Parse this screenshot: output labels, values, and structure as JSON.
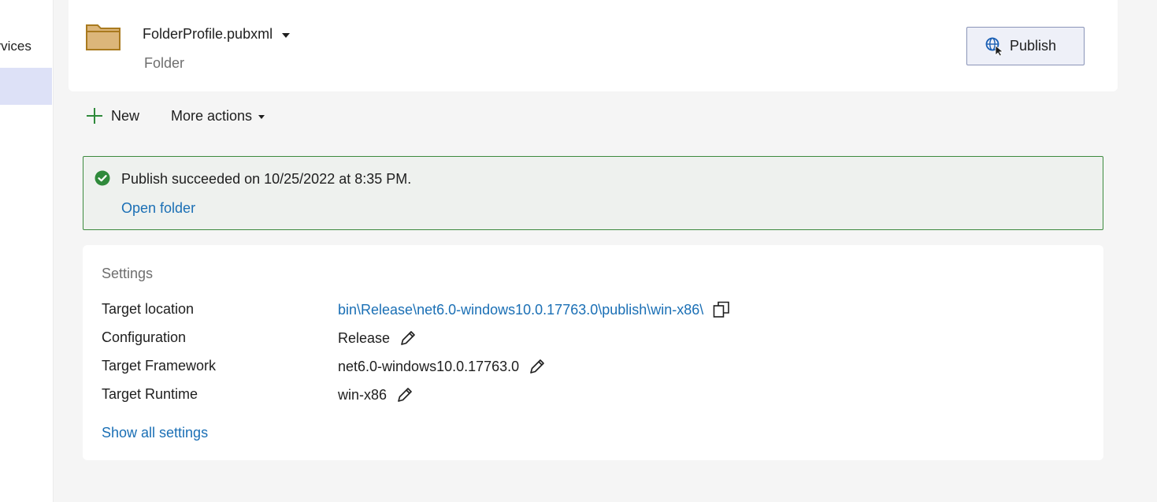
{
  "sidebar": {
    "items": [
      {
        "label": "ervices"
      }
    ]
  },
  "profile": {
    "name": "FolderProfile.pubxml",
    "type": "Folder",
    "publish_label": "Publish"
  },
  "toolbar": {
    "new_label": "New",
    "more_actions_label": "More actions"
  },
  "banner": {
    "message": "Publish succeeded on 10/25/2022 at 8:35 PM.",
    "link": "Open folder"
  },
  "settings": {
    "title": "Settings",
    "rows": [
      {
        "label": "Target location",
        "value": "bin\\Release\\net6.0-windows10.0.17763.0\\publish\\win-x86\\",
        "icon": "copy-icon"
      },
      {
        "label": "Configuration",
        "value": "Release",
        "icon": "edit-pencil-icon"
      },
      {
        "label": "Target Framework",
        "value": "net6.0-windows10.0.17763.0",
        "icon": "edit-pencil-icon"
      },
      {
        "label": "Target Runtime",
        "value": "win-x86",
        "icon": "edit-pencil-icon"
      }
    ],
    "show_all_label": "Show all settings"
  },
  "colors": {
    "accent_link": "#1a6fb5",
    "success_green": "#2f8a3b",
    "banner_border": "#3c8a3e",
    "folder_fill": "#dcb67a",
    "selected_item": "#dde1f7"
  }
}
